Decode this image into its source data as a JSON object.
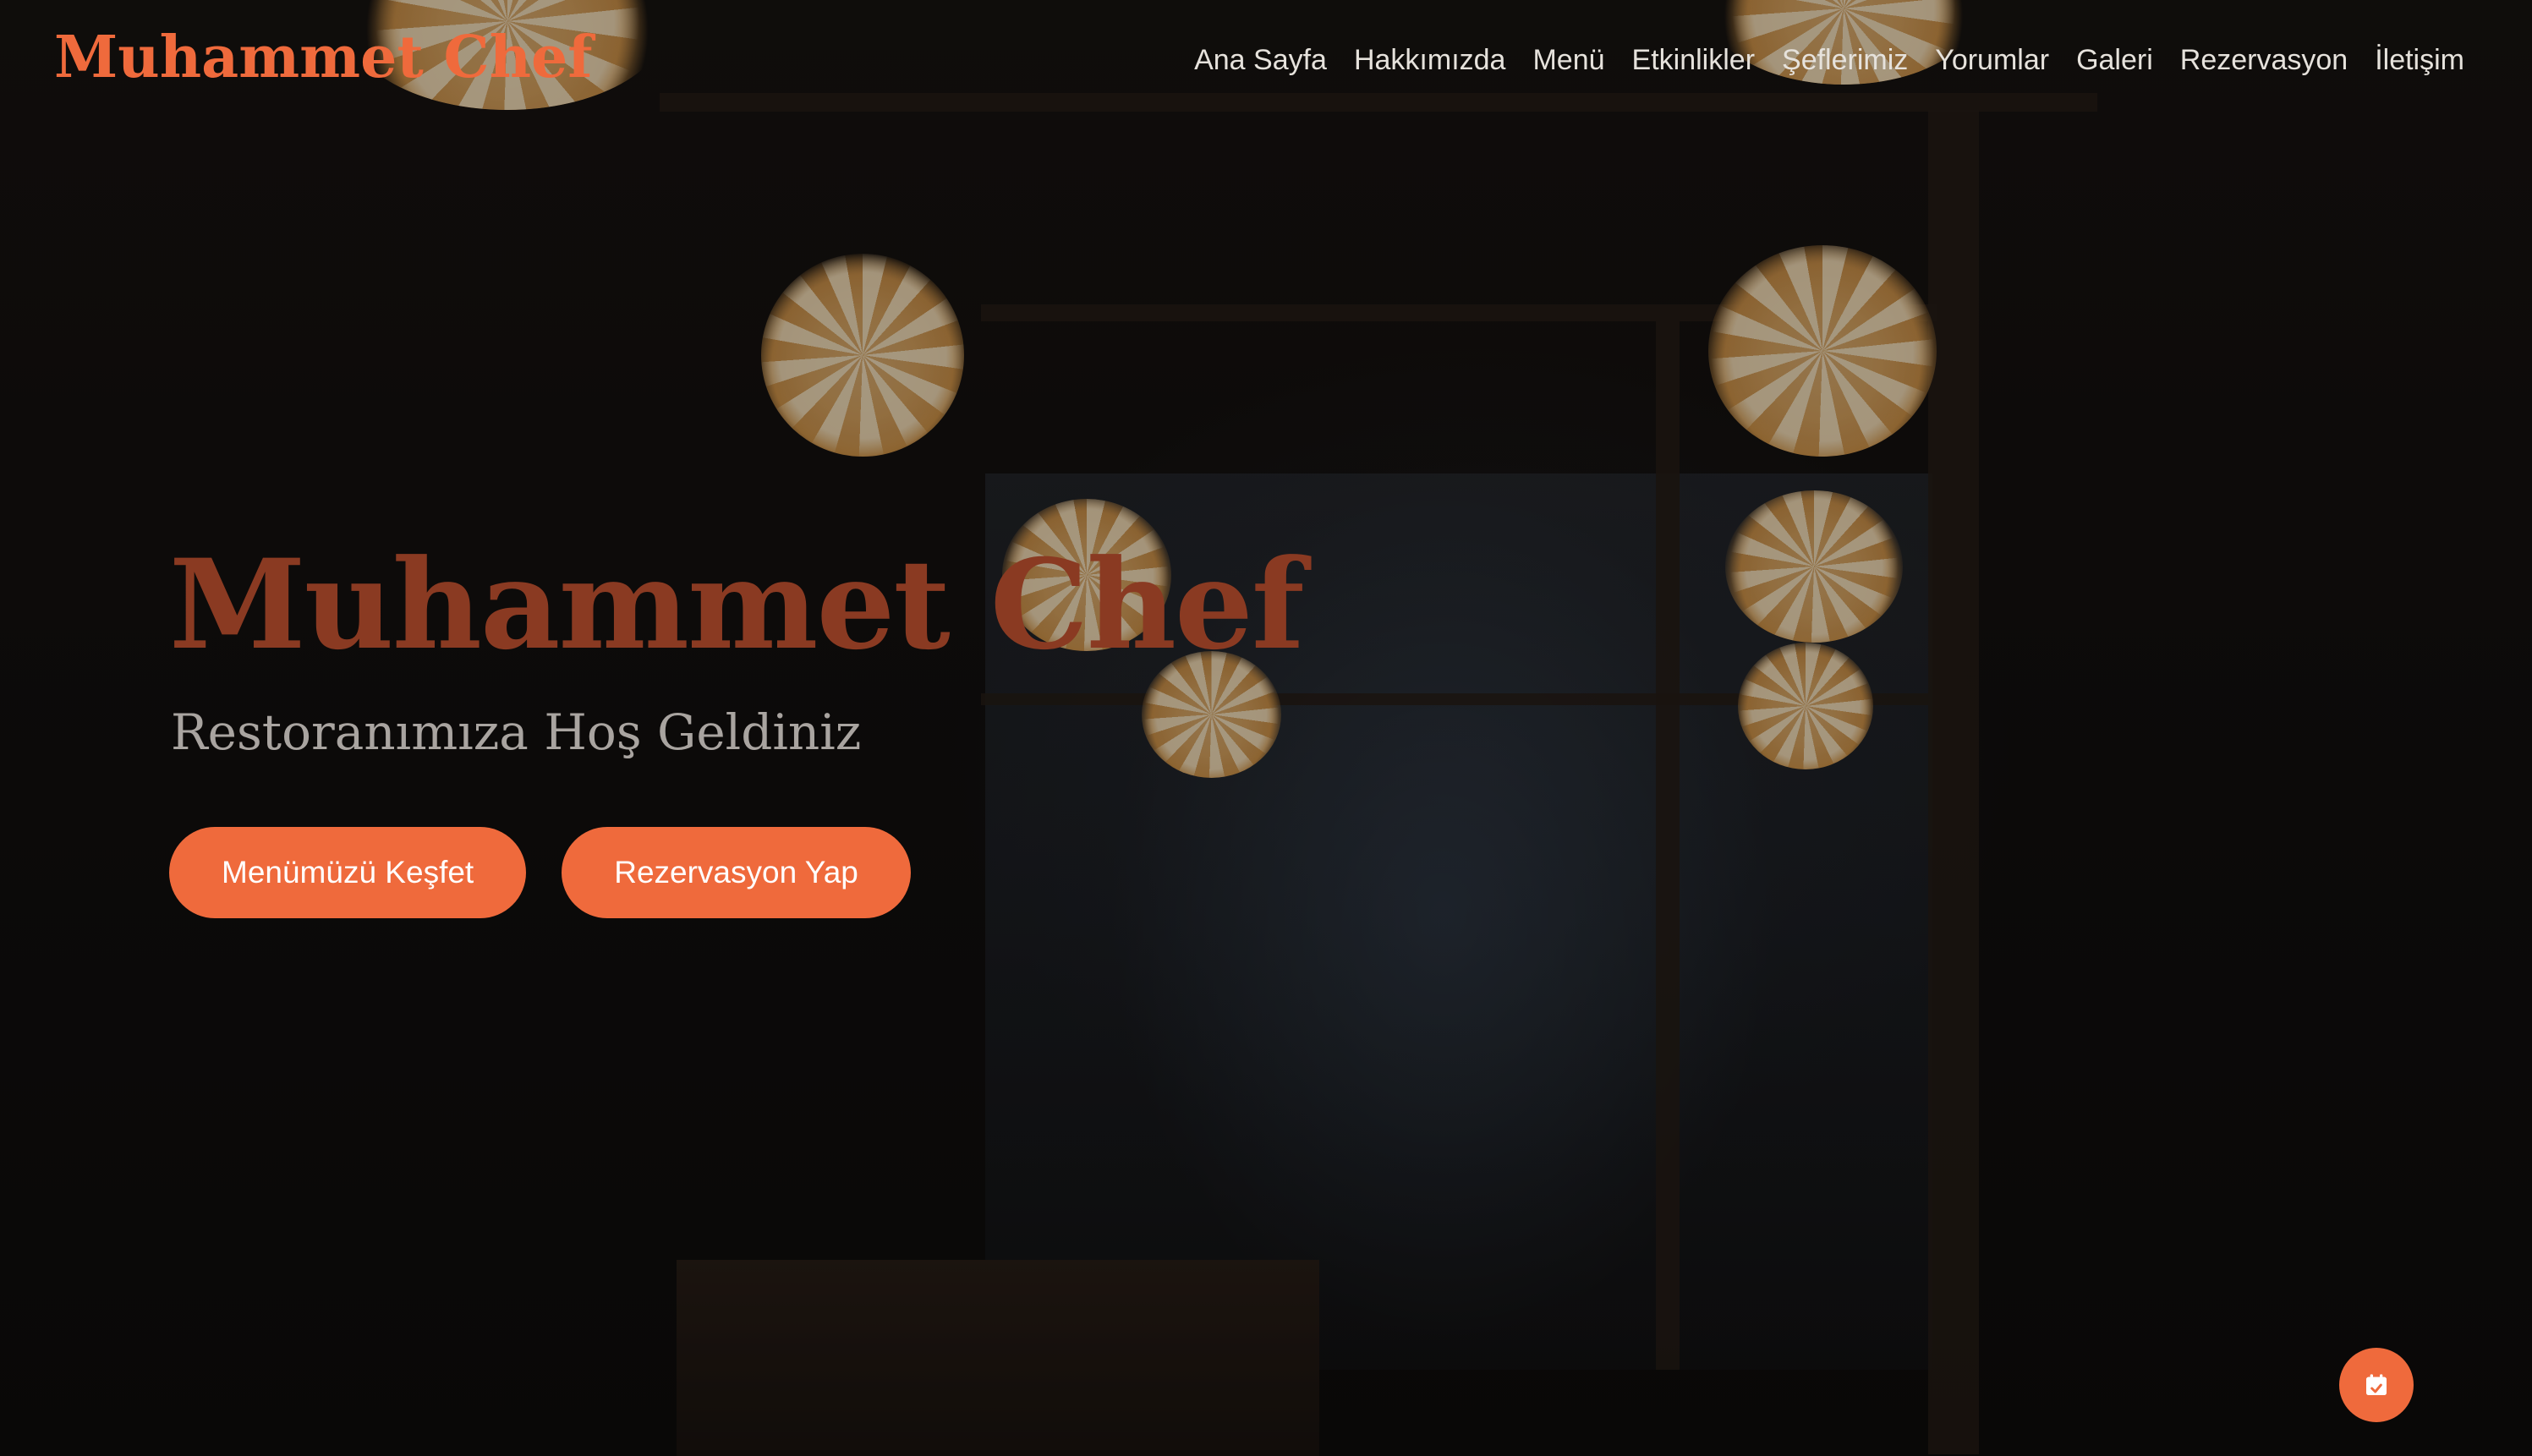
{
  "brand": {
    "logo_text": "Muhammet Chef",
    "accent_color": "#ef6a3c"
  },
  "nav": {
    "items": [
      {
        "label": "Ana Sayfa"
      },
      {
        "label": "Hakkımızda"
      },
      {
        "label": "Menü"
      },
      {
        "label": "Etkinlikler"
      },
      {
        "label": "Şeflerimiz"
      },
      {
        "label": "Yorumlar"
      },
      {
        "label": "Galeri"
      },
      {
        "label": "Rezervasyon"
      },
      {
        "label": "İletişim"
      }
    ]
  },
  "hero": {
    "title": "Muhammet Chef",
    "subtitle": "Restoranımıza Hoş Geldiniz",
    "primary_button": "Menümüzü Keşfet",
    "secondary_button": "Rezervasyon Yap",
    "background_image": "dark restaurant interior with hanging lotus pendant lamps"
  },
  "floating_action": {
    "icon": "calendar-check-icon"
  }
}
